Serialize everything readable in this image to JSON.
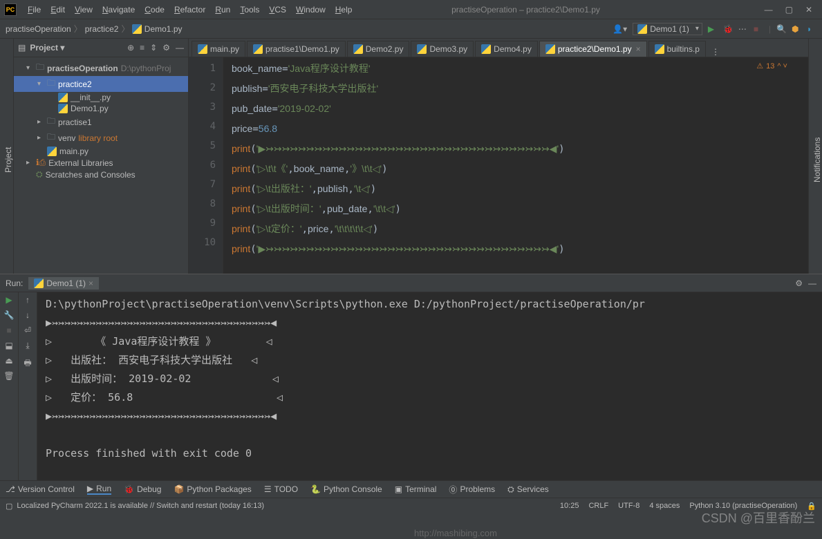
{
  "menu": [
    "File",
    "Edit",
    "View",
    "Navigate",
    "Code",
    "Refactor",
    "Run",
    "Tools",
    "VCS",
    "Window",
    "Help"
  ],
  "window_title": "practiseOperation – practice2\\Demo1.py",
  "breadcrumb": [
    "practiseOperation",
    "practice2",
    "Demo1.py"
  ],
  "run_config": "Demo1 (1)",
  "project_label": "Project",
  "tree": {
    "root": "practiseOperation",
    "root_path": "D:\\pythonProj",
    "practice2": "practice2",
    "init": "__init__.py",
    "demo1": "Demo1.py",
    "practise1": "practise1",
    "venv": "venv",
    "venv_note": "library root",
    "main": "main.py",
    "ext": "External Libraries",
    "scratch": "Scratches and Consoles"
  },
  "tabs": [
    {
      "label": "main.py",
      "active": false
    },
    {
      "label": "practise1\\Demo1.py",
      "active": false
    },
    {
      "label": "Demo2.py",
      "active": false
    },
    {
      "label": "Demo3.py",
      "active": false
    },
    {
      "label": "Demo4.py",
      "active": false
    },
    {
      "label": "practice2\\Demo1.py",
      "active": true
    },
    {
      "label": "builtins.p",
      "active": false
    }
  ],
  "editor": {
    "lines": [
      "1",
      "2",
      "3",
      "4",
      "5",
      "6",
      "7",
      "8",
      "9",
      "10"
    ],
    "code": [
      "book_name='Java程序设计教程'",
      "publish='西安电子科技大学出版社'",
      "pub_date='2019-02-02'",
      "price=56.8",
      "print('▶↣↣↣↣↣↣↣↣↣↣↣↣↣↣↣↣↣↣↣↣↣↣↣↣↣↣↣↣↣↣↣↣↣↣↣◀')",
      "print('▷\\t\\t《',book_name,'》\\t\\t◁')",
      "print('▷\\t出版社：',publish,'\\t◁')",
      "print('▷\\t出版时间：',pub_date,'\\t\\t◁')",
      "print('▷\\t定价：',price,'\\t\\t\\t\\t\\t◁')",
      "print('▶↣↣↣↣↣↣↣↣↣↣↣↣↣↣↣↣↣↣↣↣↣↣↣↣↣↣↣↣↣↣↣↣↣↣↣◀')"
    ],
    "warnings": "13"
  },
  "run": {
    "label": "Run:",
    "tab": "Demo1 (1)",
    "output": [
      "D:\\pythonProject\\practiseOperation\\venv\\Scripts\\python.exe D:/pythonProject/practiseOperation/pr",
      "▶↣↣↣↣↣↣↣↣↣↣↣↣↣↣↣↣↣↣↣↣↣↣↣↣↣↣↣↣↣↣↣↣↣↣↣◀",
      "▷       《 Java程序设计教程 》        ◁",
      "▷   出版社： 西安电子科技大学出版社   ◁",
      "▷   出版时间： 2019-02-02             ◁",
      "▷   定价： 56.8                       ◁",
      "▶↣↣↣↣↣↣↣↣↣↣↣↣↣↣↣↣↣↣↣↣↣↣↣↣↣↣↣↣↣↣↣↣↣↣↣◀",
      "",
      "Process finished with exit code 0"
    ]
  },
  "bottom_tabs": [
    "Version Control",
    "Run",
    "Debug",
    "Python Packages",
    "TODO",
    "Python Console",
    "Terminal",
    "Problems",
    "Services"
  ],
  "status": {
    "msg": "Localized PyCharm 2022.1 is available // Switch and restart (today 16:13)",
    "pos": "10:25",
    "crlf": "CRLF",
    "enc": "UTF-8",
    "spaces": "4 spaces",
    "interp": "Python 3.10 (practiseOperation)"
  },
  "watermark": "CSDN @百里香酚兰",
  "watermark2": "http://mashibing.com",
  "notifications_label": "Notifications"
}
